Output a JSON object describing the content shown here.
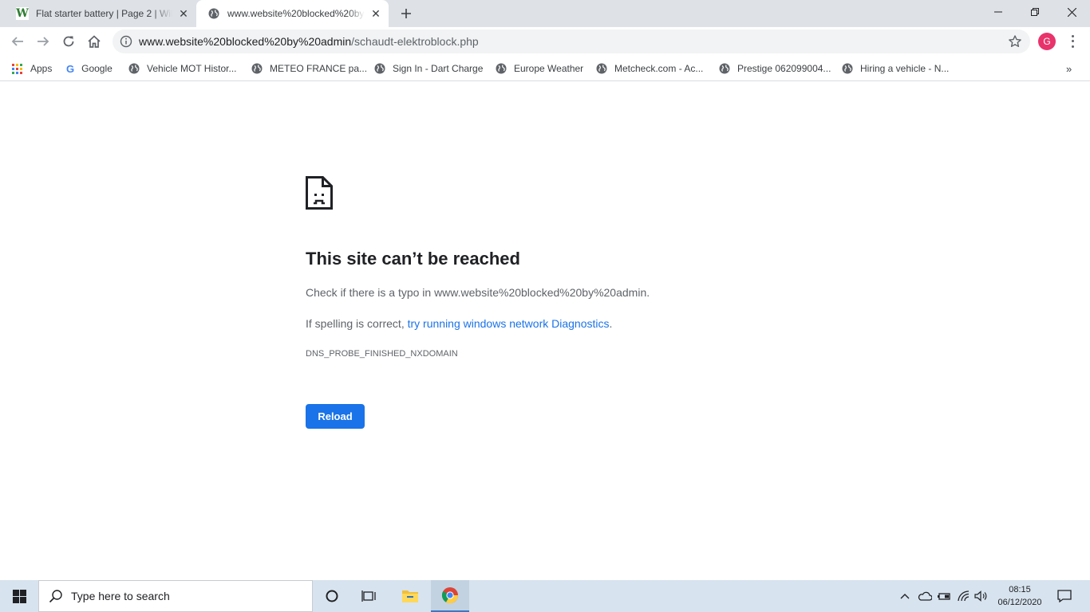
{
  "tabs": [
    {
      "title": "Flat starter battery | Page 2 | Wildcamping",
      "icon": "wildcamping-favicon"
    },
    {
      "title": "www.website%20blocked%20by%20admin",
      "icon": "globe-icon"
    }
  ],
  "address_bar": {
    "host": "www.website%20blocked%20by%20admin",
    "path": "/schaudt-elektroblock.php"
  },
  "profile": {
    "initial": "G",
    "color": "#e8336b"
  },
  "bookmarks": [
    {
      "label": "Apps",
      "icon": "apps-grid-icon"
    },
    {
      "label": "Google",
      "icon": "google-icon"
    },
    {
      "label": "Vehicle MOT Histor...",
      "icon": "globe-icon"
    },
    {
      "label": "METEO FRANCE pa...",
      "icon": "globe-icon"
    },
    {
      "label": "Sign In - Dart Charge",
      "icon": "globe-icon"
    },
    {
      "label": "Europe Weather",
      "icon": "globe-icon"
    },
    {
      "label": "Metcheck.com - Ac...",
      "icon": "globe-icon"
    },
    {
      "label": "Prestige 062099004...",
      "icon": "globe-icon"
    },
    {
      "label": "Hiring a vehicle - N...",
      "icon": "globe-icon"
    }
  ],
  "error": {
    "title": "This site can’t be reached",
    "line1": "Check if there is a typo in www.website%20blocked%20by%20admin.",
    "line2_prefix": "If spelling is correct, ",
    "line2_link": "try running windows network Diagnostics",
    "line2_suffix": ".",
    "code": "DNS_PROBE_FINISHED_NXDOMAIN",
    "reload_label": "Reload"
  },
  "taskbar": {
    "search_placeholder": "Type here to search",
    "time": "08:15",
    "date": "06/12/2020"
  },
  "colors": {
    "accent": "#1a73e8",
    "tabstrip": "#dee1e6",
    "taskbar": "#d7e3ee"
  }
}
